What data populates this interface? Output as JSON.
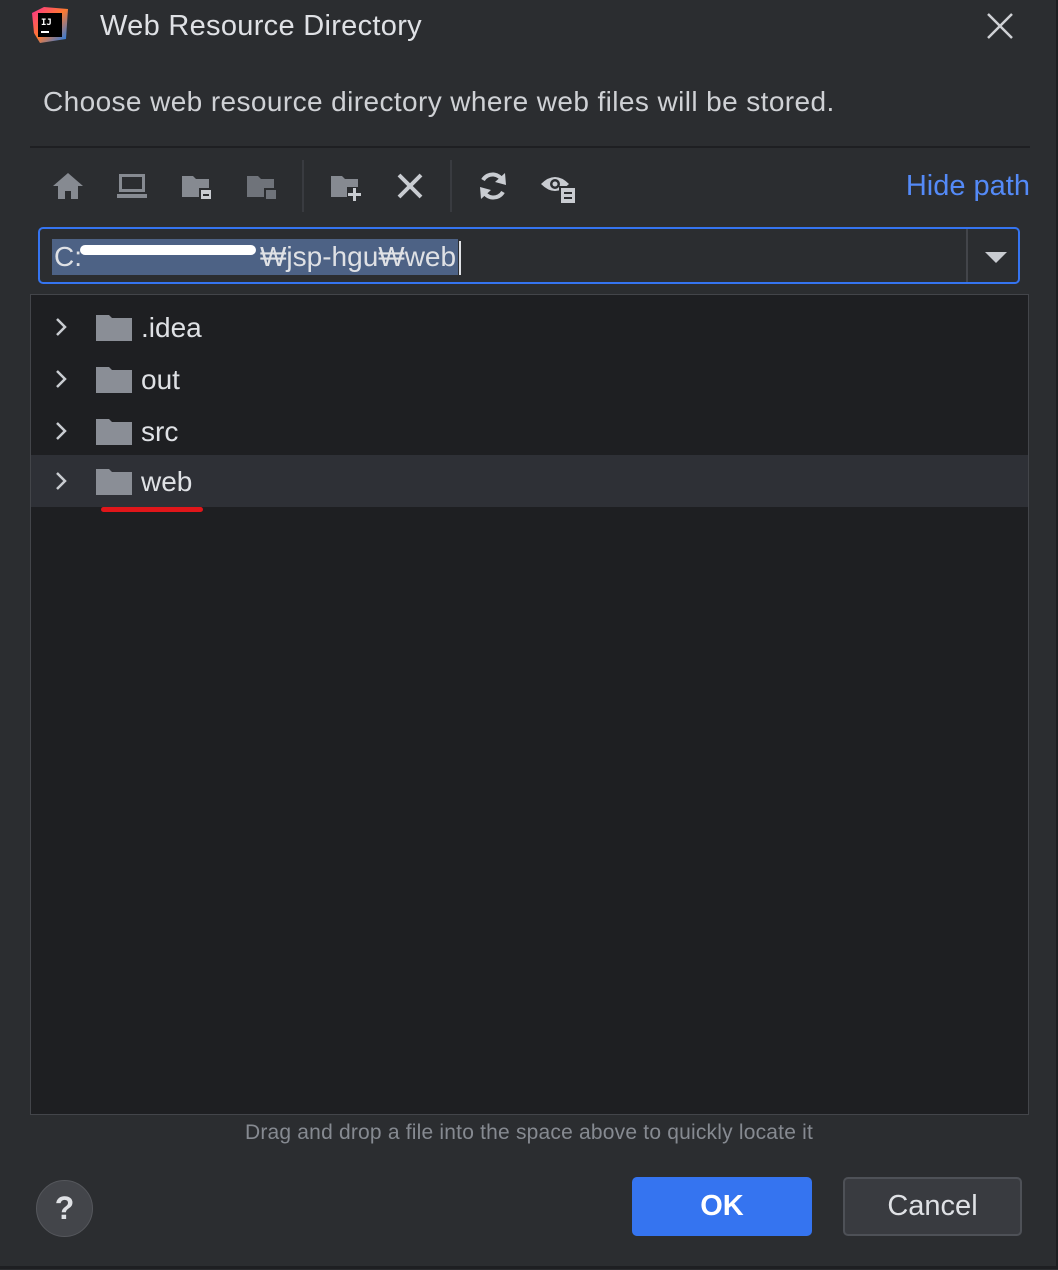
{
  "window": {
    "title": "Web Resource Directory",
    "app_icon": "intellij-idea-icon",
    "close_icon": "close-icon"
  },
  "description": "Choose web resource directory where web files will be stored.",
  "toolbar": {
    "buttons": [
      {
        "icon": "home-icon"
      },
      {
        "icon": "desktop-icon"
      },
      {
        "icon": "project-folder-icon"
      },
      {
        "icon": "module-folder-icon"
      },
      {
        "icon": "new-folder-icon"
      },
      {
        "icon": "delete-icon"
      },
      {
        "icon": "refresh-icon"
      },
      {
        "icon": "show-hidden-files-icon"
      }
    ],
    "hide_path_label": "Hide path"
  },
  "path_field": {
    "value": "C:₩Users₩thisis₩jsp-hgu₩web",
    "visible_prefix": "C:",
    "visible_suffix": "₩jsp-hgu₩web"
  },
  "tree": {
    "items": [
      {
        "label": ".idea",
        "icon": "folder-icon"
      },
      {
        "label": "out",
        "icon": "folder-icon"
      },
      {
        "label": "src",
        "icon": "folder-icon"
      },
      {
        "label": "web",
        "icon": "folder-icon",
        "selected": true
      }
    ]
  },
  "hint": "Drag and drop a file into the space above to quickly locate it",
  "footer": {
    "help_label": "?",
    "ok_label": "OK",
    "cancel_label": "Cancel"
  },
  "colors": {
    "background": "#2b2d30",
    "tree_background": "#1e1f22",
    "accent": "#3574f0",
    "link": "#548af7",
    "annotation_red": "#e0161a"
  }
}
